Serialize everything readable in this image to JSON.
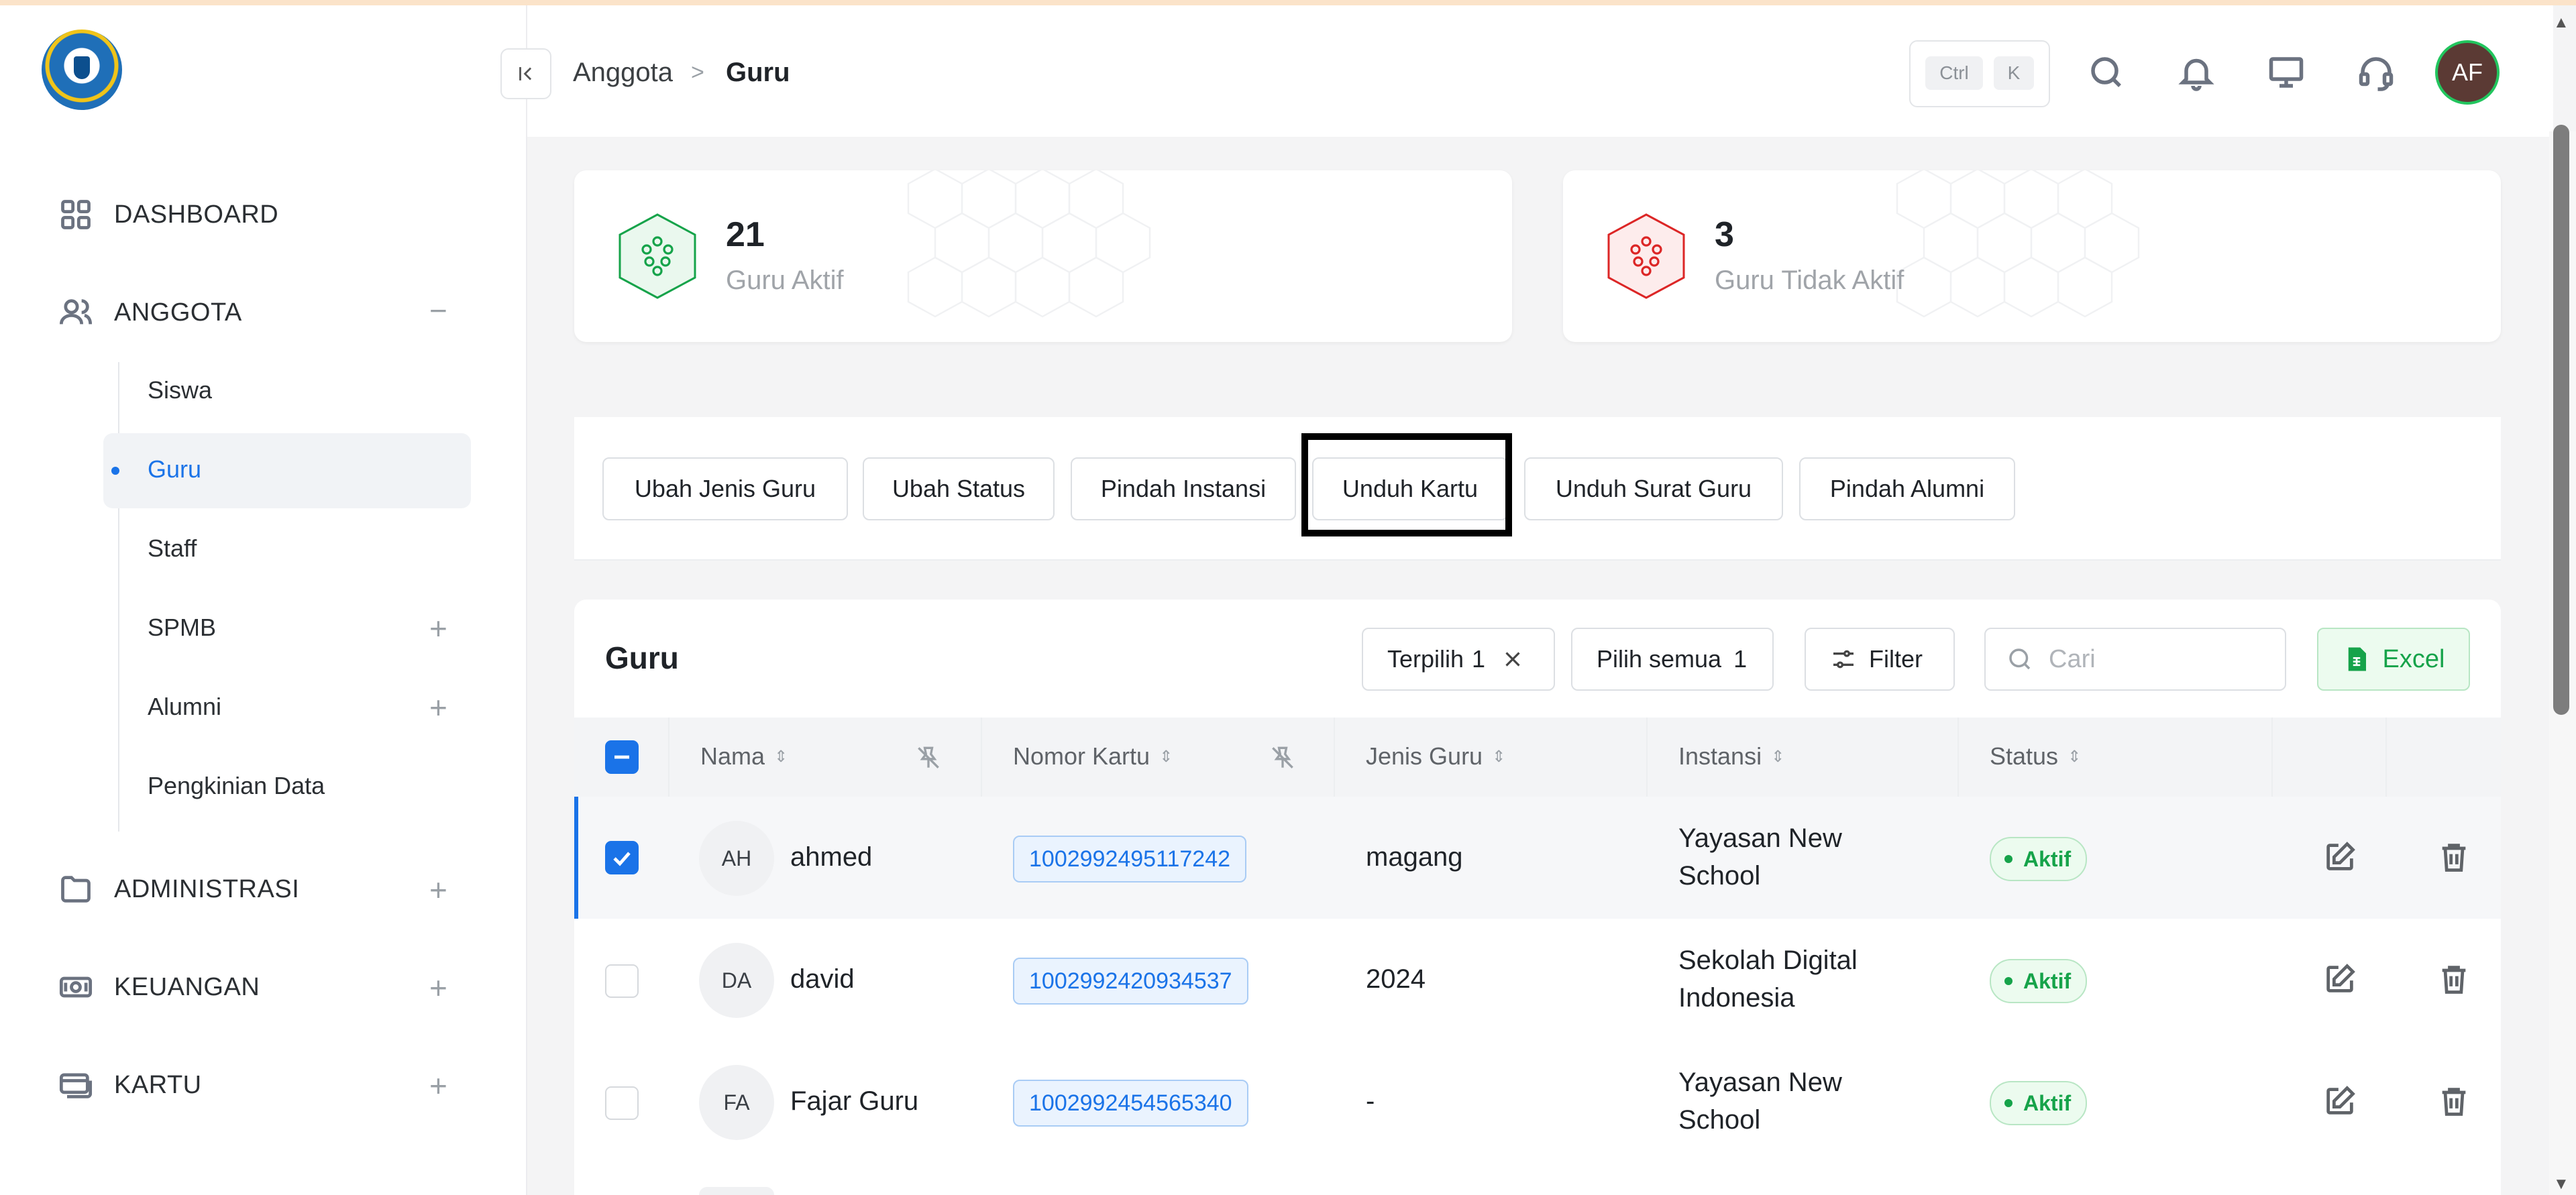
{
  "sidebar": {
    "items": [
      {
        "label": "DASHBOARD",
        "icon": "grid-icon"
      },
      {
        "label": "ANGGOTA",
        "icon": "users-icon",
        "toggle": "−"
      },
      {
        "label": "ADMINISTRASI",
        "icon": "folder-icon",
        "toggle": "+"
      },
      {
        "label": "KEUANGAN",
        "icon": "money-icon",
        "toggle": "+"
      },
      {
        "label": "KARTU",
        "icon": "card-icon",
        "toggle": "+"
      }
    ],
    "anggota_sub": [
      {
        "label": "Siswa"
      },
      {
        "label": "Guru",
        "active": true
      },
      {
        "label": "Staff"
      },
      {
        "label": "SPMB",
        "toggle": "+"
      },
      {
        "label": "Alumni",
        "toggle": "+"
      },
      {
        "label": "Pengkinian Data"
      }
    ]
  },
  "header": {
    "breadcrumb": [
      "Anggota",
      "Guru"
    ],
    "breadcrumb_sep": ">",
    "kbd": [
      "Ctrl",
      "K"
    ],
    "avatar_initials": "AF"
  },
  "stats": [
    {
      "value": "21",
      "label": "Guru Aktif",
      "color": "#16a34a"
    },
    {
      "value": "3",
      "label": "Guru Tidak Aktif",
      "color": "#dc2626"
    }
  ],
  "actions": [
    "Ubah Jenis Guru",
    "Ubah Status",
    "Pindah Instansi",
    "Unduh Kartu",
    "Unduh Surat Guru",
    "Pindah Alumni"
  ],
  "table": {
    "title": "Guru",
    "selected_label": "Terpilih",
    "selected_count": "1",
    "select_all_label": "Pilih semua",
    "select_all_count": "1",
    "filter_label": "Filter",
    "search_placeholder": "Cari",
    "excel_label": "Excel",
    "columns": [
      "Nama",
      "Nomor Kartu",
      "Jenis Guru",
      "Instansi",
      "Status"
    ],
    "rows": [
      {
        "initials": "AH",
        "name": "ahmed",
        "card": "1002992495117242",
        "jenis": "magang",
        "instansi_1": "Yayasan New",
        "instansi_2": "School",
        "status": "Aktif",
        "checked": true
      },
      {
        "initials": "DA",
        "name": "david",
        "card": "1002992420934537",
        "jenis": "2024",
        "instansi_1": "Sekolah Digital",
        "instansi_2": "Indonesia",
        "status": "Aktif",
        "checked": false
      },
      {
        "initials": "FA",
        "name": "Fajar Guru",
        "card": "1002992454565340",
        "jenis": "-",
        "instansi_1": "Yayasan New",
        "instansi_2": "School",
        "status": "Aktif",
        "checked": false
      }
    ]
  },
  "colors": {
    "accent": "#1a73e8",
    "success": "#16a34a",
    "danger": "#dc2626"
  }
}
